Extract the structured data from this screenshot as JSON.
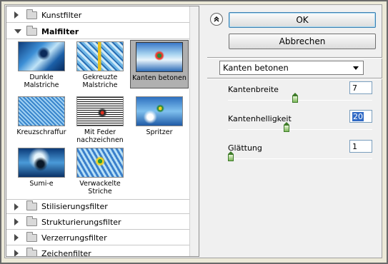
{
  "gallery": {
    "categories_top": [
      {
        "label": "Kunstfilter",
        "expanded": false
      },
      {
        "label": "Malfilter",
        "expanded": true
      }
    ],
    "thumbnails": [
      {
        "label": "Dunkle Malstriche",
        "selected": false
      },
      {
        "label": "Gekreuzte Malstriche",
        "selected": false
      },
      {
        "label": "Kanten betonen",
        "selected": true
      },
      {
        "label": "Kreuzschraffur",
        "selected": false
      },
      {
        "label": "Mit Feder nachzeichnen",
        "selected": false
      },
      {
        "label": "Spritzer",
        "selected": false
      },
      {
        "label": "Sumi-e",
        "selected": false
      },
      {
        "label": "Verwackelte Striche",
        "selected": false
      }
    ],
    "categories_bottom": [
      {
        "label": "Stilisierungsfilter",
        "expanded": false
      },
      {
        "label": "Strukturierungsfilter",
        "expanded": false
      },
      {
        "label": "Verzerrungsfilter",
        "expanded": false
      },
      {
        "label": "Zeichenfilter",
        "expanded": false
      }
    ]
  },
  "panel": {
    "collapse_icon": "double-chevron-up-icon",
    "ok_label": "OK",
    "cancel_label": "Abbrechen",
    "filter_select": "Kanten betonen",
    "params": [
      {
        "label": "Kantenbreite",
        "value": "7",
        "min": 1,
        "max": 14,
        "level": 7
      },
      {
        "label": "Kantenhelligkeit",
        "value": "20",
        "min": 0,
        "max": 50,
        "level": 20
      },
      {
        "label": "Glättung",
        "value": "1",
        "min": 1,
        "max": 15,
        "level": 1
      }
    ]
  }
}
